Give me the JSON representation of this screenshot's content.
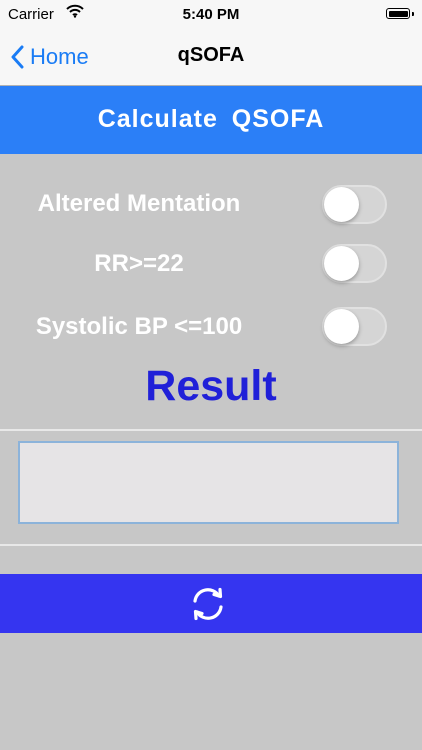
{
  "status_bar": {
    "carrier": "Carrier",
    "time": "5:40 PM"
  },
  "nav": {
    "back_label": "Home",
    "title": "qSOFA"
  },
  "header": {
    "label": "Calculate  QSOFA"
  },
  "criteria": [
    {
      "label": "Altered Mentation",
      "on": false
    },
    {
      "label": "RR>=22",
      "on": false
    },
    {
      "label": "Systolic BP <=100",
      "on": false
    }
  ],
  "result": {
    "title": "Result",
    "value": ""
  },
  "colors": {
    "accent_blue": "#1a7cf5",
    "header_blue": "#2b7ff7",
    "result_text": "#2020d8",
    "reset_bar": "#3535f0",
    "background": "#c7c7c7"
  },
  "icons": {
    "back": "chevron-left-icon",
    "wifi": "wifi-icon",
    "battery": "battery-icon",
    "reset": "refresh-icon"
  }
}
